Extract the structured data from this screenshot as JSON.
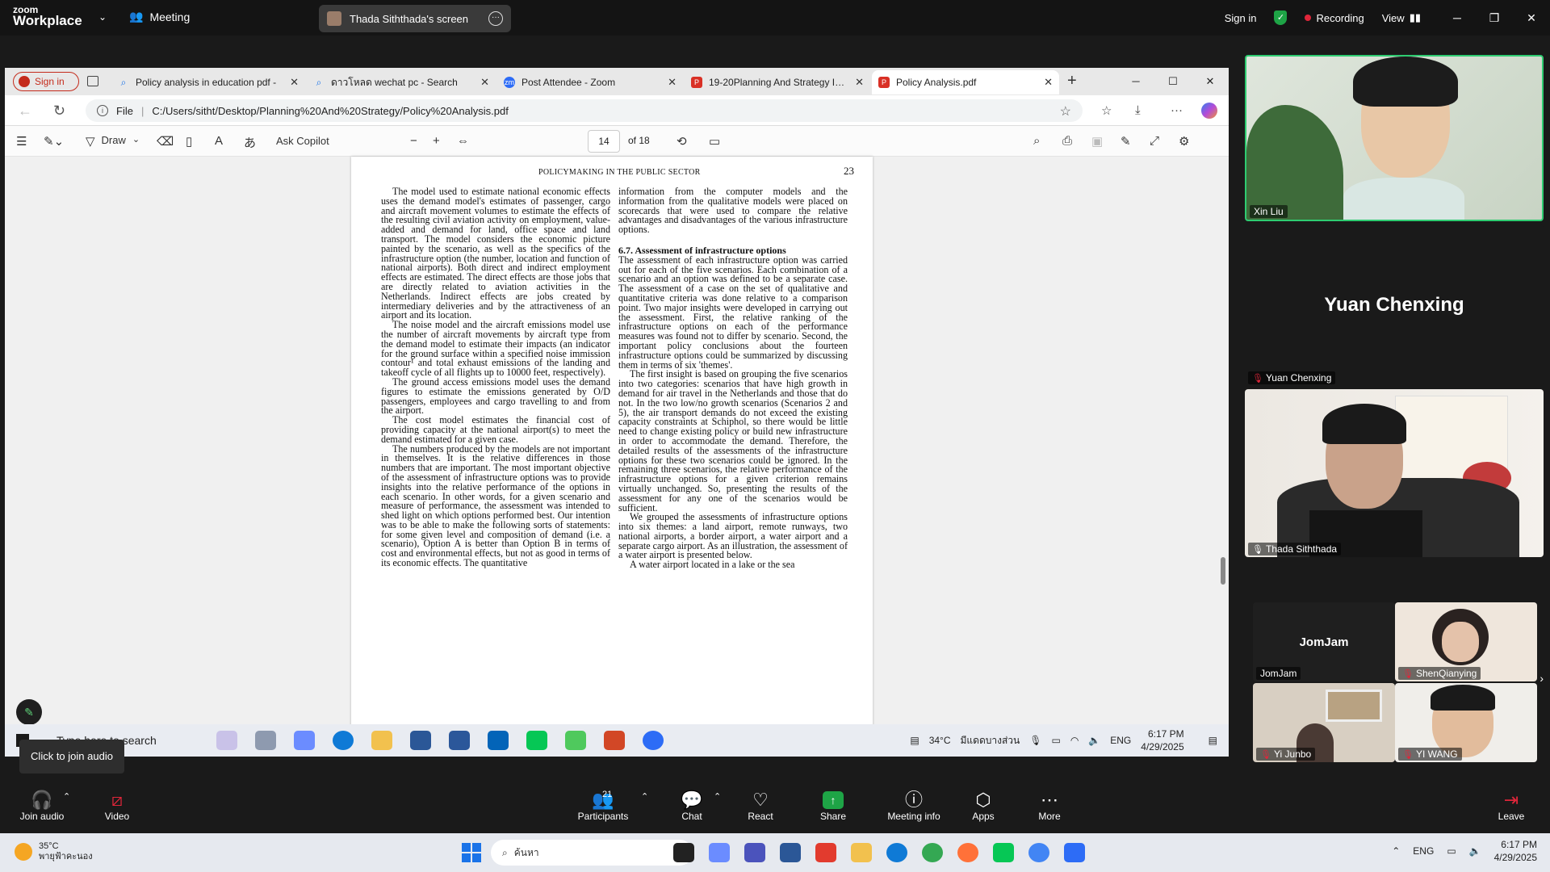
{
  "zoom": {
    "brand_top": "zoom",
    "brand_bottom": "Workplace",
    "meeting_label": "Meeting",
    "screen_share_label": "Thada Siththada's screen",
    "sign_in": "Sign in",
    "recording": "Recording",
    "view": "View",
    "bottom": {
      "join_audio": "Join audio",
      "video": "Video",
      "participants": "Participants",
      "participants_count": "21",
      "chat": "Chat",
      "react": "React",
      "share": "Share",
      "meeting_info": "Meeting info",
      "apps": "Apps",
      "more": "More",
      "leave": "Leave"
    },
    "tooltip": "Click to join audio",
    "participants": [
      {
        "name": "Xin Liu",
        "type": "video"
      },
      {
        "name": "Yuan Chenxing",
        "type": "name-only",
        "big": "Yuan Chenxing"
      },
      {
        "name": "Thada Siththada",
        "type": "video"
      },
      {
        "name": "JomJam",
        "type": "name-only",
        "big": "JomJam"
      },
      {
        "name": "ShenQianying",
        "type": "video"
      },
      {
        "name": "Yi Junbo",
        "type": "video"
      },
      {
        "name": "YI WANG",
        "type": "video"
      }
    ]
  },
  "browser": {
    "sign_in": "Sign in",
    "tabs": [
      {
        "title": "Policy analysis in education pdf -",
        "icon": "search-icon"
      },
      {
        "title": "ดาวโหลด wechat pc - Search",
        "icon": "search-icon"
      },
      {
        "title": "Post Attendee - Zoom",
        "icon": "zoom-icon"
      },
      {
        "title": "19-20Planning And Strategy In E",
        "icon": "pdf-icon"
      },
      {
        "title": "Policy Analysis.pdf",
        "icon": "pdf-icon",
        "active": true
      }
    ],
    "url_label": "File",
    "url": "C:/Users/sitht/Desktop/Planning%20And%20Strategy/Policy%20Analysis.pdf",
    "pdf_toolbar": {
      "draw": "Draw",
      "ask_copilot": "Ask Copilot",
      "page": "14",
      "of_pages": "of 18"
    }
  },
  "pdf": {
    "running_head": "POLICYMAKING IN THE PUBLIC SECTOR",
    "page_number": "23",
    "col1": [
      "The model used to estimate national economic effects uses the demand model's estimates of passenger, cargo and aircraft movement volumes to estimate the effects of the resulting civil aviation activity on employment, value-added and demand for land, office space and land transport. The model considers the economic picture painted by the scenario, as well as the specifics of the infrastructure option (the number, location and function of national airports). Both direct and indirect employment effects are estimated. The direct effects are those jobs that are directly related to aviation activities in the Netherlands. Indirect effects are jobs created by intermediary deliveries and by the attractiveness of an airport and its location.",
      "The noise model and the aircraft emissions model use the number of aircraft movements by aircraft type from the demand model to estimate their impacts (an indicator for the ground surface within a specified noise immission contour¹ and total exhaust emissions of the landing and takeoff cycle of all flights up to 10000 feet, respectively).",
      "The ground access emissions model uses the demand figures to estimate the emissions generated by O/D passengers, employees and cargo travelling to and from the airport.",
      "The cost model estimates the financial cost of providing capacity at the national airport(s) to meet the demand estimated for a given case.",
      "The numbers produced by the models are not important in themselves. It is the relative differences in those numbers that are important. The most important objective of the assessment of infrastructure options was to provide insights into the relative performance of the options in each scenario. In other words, for a given scenario and measure of performance, the assessment was intended to shed light on which options performed best. Our intention was to be able to make the following sorts of statements: for some given level and composition of demand (i.e. a scenario), Option A is better than Option B in terms of cost and environmental effects, but not as good in terms of its economic effects. The quantitative"
    ],
    "col2_intro": "information from the computer models and the information from the qualitative models were placed on scorecards that were used to compare the relative advantages and disadvantages of the various infrastructure options.",
    "col2_heading": "6.7. Assessment of infrastructure options",
    "col2": [
      "The assessment of each infrastructure option was carried out for each of the five scenarios. Each combination of a scenario and an option was defined to be a separate case. The assessment of a case on the set of qualitative and quantitative criteria was done relative to a comparison point. Two major insights were developed in carrying out the assessment. First, the relative ranking of the infrastructure options on each of the performance measures was found not to differ by scenario. Second, the important policy conclusions about the fourteen infrastructure options could be summarized by discussing them in terms of six 'themes'.",
      "The first insight is based on grouping the five scenarios into two categories: scenarios that have high growth in demand for air travel in the Netherlands and those that do not. In the two low/no growth scenarios (Scenarios 2 and 5), the air transport demands do not exceed the existing capacity constraints at Schiphol, so there would be little need to change existing policy or build new infrastructure in order to accommodate the demand. Therefore, the detailed results of the assessments of the infrastructure options for these two scenarios could be ignored. In the remaining three scenarios, the relative performance of the infrastructure options for a given criterion remains virtually unchanged. So, presenting the results of the assessment for any one of the scenarios would be sufficient.",
      "We grouped the assessments of infrastructure options into six themes: a land airport, remote runways, two national airports, a border airport, a water airport and a separate cargo airport. As an illustration, the assessment of a water airport is presented below.",
      "A water airport located in a lake or the sea"
    ]
  },
  "inner_taskbar": {
    "search": "Type here to search",
    "temp": "34°C",
    "weather": "มีแดดบางส่วน",
    "lang": "ENG",
    "time": "6:17 PM",
    "date": "4/29/2025"
  },
  "win_taskbar": {
    "temp": "35°C",
    "weather": "พายุฟ้าคะนอง",
    "search": "ค้นหา",
    "lang": "ENG",
    "time": "6:17 PM",
    "date": "4/29/2025"
  }
}
